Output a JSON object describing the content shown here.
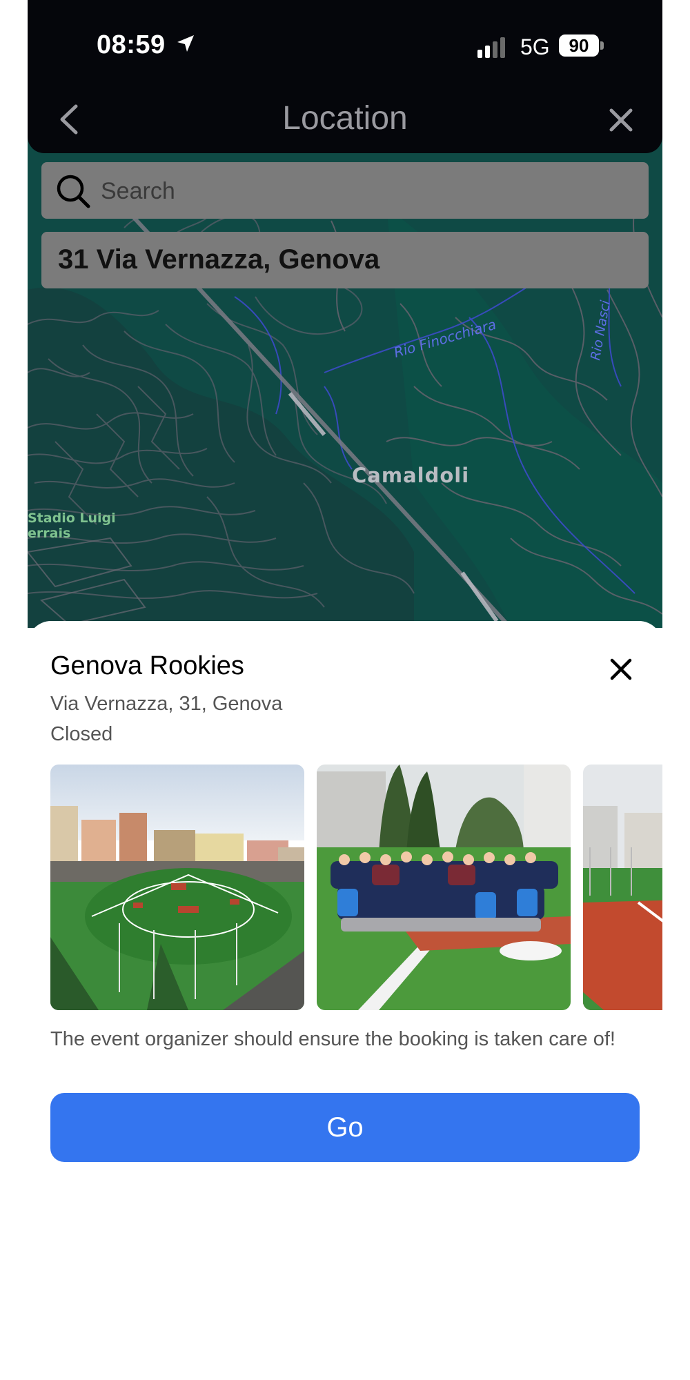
{
  "status_bar": {
    "time": "08:59",
    "network": "5G",
    "battery": "90"
  },
  "nav": {
    "title": "Location"
  },
  "search": {
    "placeholder": "Search",
    "value": ""
  },
  "address": {
    "value": "31 Via Vernazza, Genova"
  },
  "map": {
    "labels": {
      "area": "Camaldoli",
      "river1": "Rio Finocchiara",
      "river2": "Rio Nasci",
      "stadium_line1": "Stadio Luigi",
      "stadium_line2": "errais"
    }
  },
  "venue": {
    "name": "Genova Rookies",
    "address": "Via Vernazza, 31, Genova",
    "status": "Closed",
    "note": "The event organizer should ensure the booking is taken care of!",
    "go_label": "Go"
  },
  "colors": {
    "accent": "#3475ef",
    "map_bg": "#0f4a45",
    "topbar_bg": "#05060b"
  }
}
